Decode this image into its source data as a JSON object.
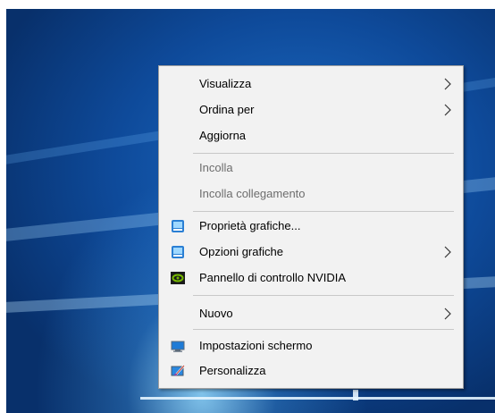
{
  "context_menu": {
    "items": [
      {
        "label": "Visualizza",
        "has_submenu": true,
        "enabled": true
      },
      {
        "label": "Ordina per",
        "has_submenu": true,
        "enabled": true
      },
      {
        "label": "Aggiorna",
        "has_submenu": false,
        "enabled": true
      },
      {
        "label": "Incolla",
        "has_submenu": false,
        "enabled": false
      },
      {
        "label": "Incolla collegamento",
        "has_submenu": false,
        "enabled": false
      },
      {
        "label": "Proprietà grafiche...",
        "has_submenu": false,
        "enabled": true,
        "icon": "intel-graphics-icon"
      },
      {
        "label": "Opzioni grafiche",
        "has_submenu": true,
        "enabled": true,
        "icon": "intel-graphics-icon"
      },
      {
        "label": "Pannello di controllo NVIDIA",
        "has_submenu": false,
        "enabled": true,
        "icon": "nvidia-icon"
      },
      {
        "label": "Nuovo",
        "has_submenu": true,
        "enabled": true
      },
      {
        "label": "Impostazioni schermo",
        "has_submenu": false,
        "enabled": true,
        "icon": "display-settings-icon"
      },
      {
        "label": "Personalizza",
        "has_submenu": false,
        "enabled": true,
        "icon": "personalize-icon"
      }
    ]
  },
  "colors": {
    "menu_background": "#f2f2f2",
    "disabled_text": "#6d6d6d",
    "desktop_blue": "#0e4a9a"
  }
}
